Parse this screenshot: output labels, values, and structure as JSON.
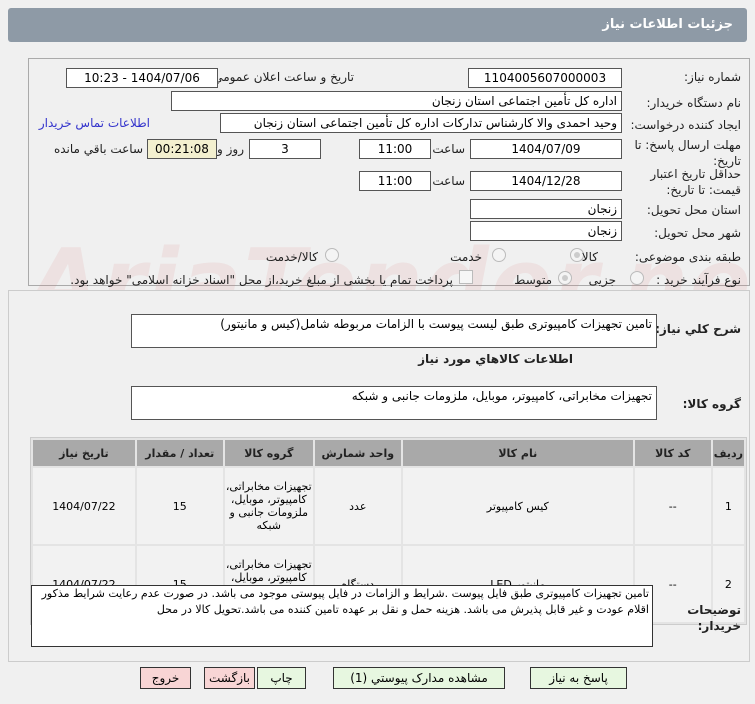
{
  "header": {
    "title": "جزئیات اطلاعات نیاز"
  },
  "form": {
    "need_number_label": "شماره نیاز:",
    "need_number": "1104005607000003",
    "announce_label": "تاریخ و ساعت اعلان عمومي:",
    "announce_value": "1404/07/06 - 10:23",
    "buyer_label": "نام دستگاه خریدار:",
    "buyer": "اداره کل تأمین اجتماعی استان زنجان",
    "creator_label": "ایجاد کننده درخواست:",
    "creator": "وحید احمدی والا کارشناس تدارکات اداره کل تأمین اجتماعی استان زنجان",
    "contact_link": "اطلاعات تماس خریدار",
    "deadline_label": "مهلت ارسال پاسخ: تا تاریخ:",
    "deadline_date": "1404/07/09",
    "time_label": "ساعت",
    "deadline_time": "11:00",
    "days": "3",
    "days_label": "روز و",
    "remaining": "00:21:08",
    "remaining_label": "ساعت باقي مانده",
    "validity_label": "حداقل تاریخ اعتبار قیمت: تا تاریخ:",
    "validity_date": "1404/12/28",
    "validity_time": "11:00",
    "province_label": "استان محل تحویل:",
    "province": "زنجان",
    "city_label": "شهر محل تحویل:",
    "city": "زنجان",
    "category_label": "طبقه بندی موضوعی:",
    "category_options": [
      "کالا",
      "خدمت",
      "کالا/خدمت"
    ],
    "process_label": "نوع فرآیند خرید :",
    "process_options": [
      "جزیی",
      "متوسط"
    ],
    "payment_note": "پرداخت تمام یا بخشی از مبلغ خرید،از محل \"اسناد خزانه اسلامی\" خواهد بود."
  },
  "summary": {
    "label": "شرح کلي نیاز:",
    "value": "تامین تجهیزات کامپیوتری طبق لیست پیوست با الزامات مربوطه شامل(کیس و مانیتور)"
  },
  "goods": {
    "title": "اطلاعات کالاهاي مورد نیاز",
    "group_label": "گروه کالا:",
    "group_value": "تجهیزات مخابراتی، کامپیوتر، موبایل، ملزومات جانبی و شبکه",
    "columns": [
      "ردیف",
      "کد کالا",
      "نام کالا",
      "واحد شمارش",
      "گروه کالا",
      "تعداد / مقدار",
      "تاریخ نیاز"
    ],
    "rows": [
      [
        "1",
        "--",
        "کیس کامپیوتر",
        "عدد",
        "تجهیزات مخابراتی، کامپیوتر، موبایل، ملزومات جانبی و شبکه",
        "15",
        "1404/07/22"
      ],
      [
        "2",
        "--",
        "مانیتور LED",
        "دستگاه",
        "تجهیزات مخابراتی، کامپیوتر، موبایل، ملزومات جانبی و شبکه",
        "15",
        "1404/07/22"
      ]
    ]
  },
  "notes": {
    "label": "توضیحات خریدار:",
    "value": "تامین تجهیزات کامپیوتری  طبق فایل پیوست .شرایط و الزامات در فایل پیوستی موجود می باشد. در صورت عدم رعایت شرایط مذکور اقلام عودت و غیر قابل پذیرش می باشد. هزینه حمل و نقل بر عهده تامین کننده می باشد.تحویل کالا در محل"
  },
  "buttons": {
    "reply": "پاسخ به نیاز",
    "attachments": "مشاهده مدارک پیوستي (1)",
    "print": "چاپ",
    "back": "بازگشت",
    "exit": "خروج"
  },
  "watermark": "AriaTender.net"
}
